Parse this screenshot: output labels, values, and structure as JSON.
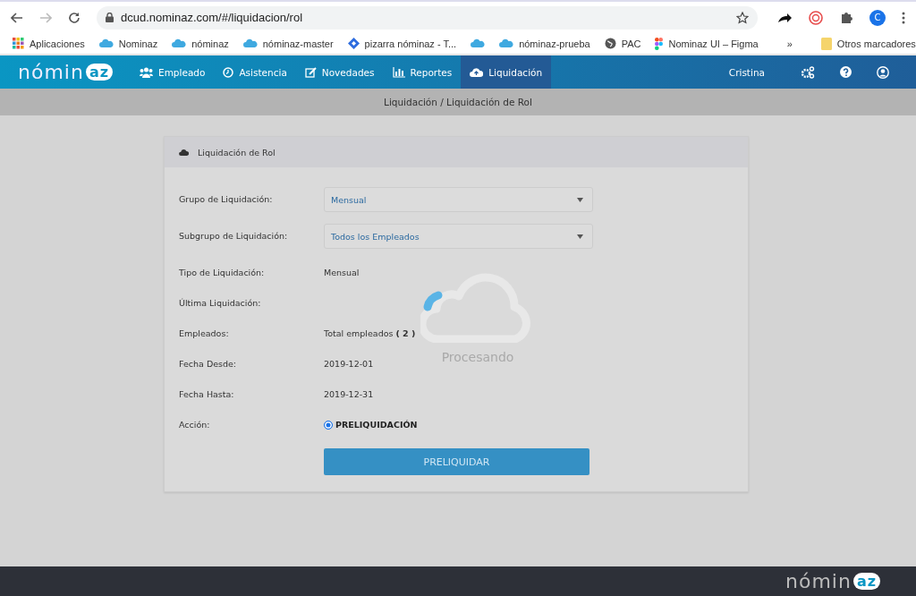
{
  "browser": {
    "url": "dcud.nominaz.com/#/liquidacion/rol",
    "profile_initial": "C",
    "bookmarks": [
      {
        "label": "Aplicaciones",
        "kind": "apps"
      },
      {
        "label": "Nominaz",
        "kind": "cloud"
      },
      {
        "label": "nóminaz",
        "kind": "cloud"
      },
      {
        "label": "nóminaz-master",
        "kind": "cloud"
      },
      {
        "label": "pizarra nóminaz - T...",
        "kind": "diamond"
      },
      {
        "kind": "cloud"
      },
      {
        "label": "nóminaz-prueba",
        "kind": "cloud"
      },
      {
        "label": "PAC",
        "kind": "globe"
      },
      {
        "label": "Nominaz UI – Figma",
        "kind": "figma"
      }
    ],
    "overflow": "»",
    "other_bookmarks": "Otros marcadores"
  },
  "logo": {
    "main": "nómin",
    "accent": "az"
  },
  "nav": [
    {
      "label": "Empleado",
      "selected": false
    },
    {
      "label": "Asistencia",
      "selected": false
    },
    {
      "label": "Novedades",
      "selected": false
    },
    {
      "label": "Reportes",
      "selected": false
    },
    {
      "label": "Liquidación",
      "selected": true
    }
  ],
  "user": "Cristina",
  "breadcrumb": "Liquidación / Liquidación de Rol",
  "card": {
    "title": "Liquidación de Rol",
    "rows": [
      {
        "label": "Grupo de Liquidación:",
        "kind": "select",
        "value": "Mensual"
      },
      {
        "label": "Subgrupo de Liquidación:",
        "kind": "select",
        "value": "Todos los Empleados"
      },
      {
        "label": "Tipo de Liquidación:",
        "kind": "text",
        "value": "Mensual"
      },
      {
        "label": "Última Liquidación:",
        "kind": "text"
      },
      {
        "label": "Empleados:",
        "kind": "text",
        "value": "Total empleados **( 2 )**"
      },
      {
        "label": "Fecha Desde:",
        "kind": "text",
        "value": "2019-12-01"
      },
      {
        "label": "Fecha Hasta:",
        "kind": "text",
        "value": "2019-12-31"
      },
      {
        "label": "Acción:",
        "kind": "radio",
        "value": "PRELIQUIDACIÓN",
        "selected": true
      }
    ],
    "button": "PRELIQUIDAR"
  },
  "overlay": {
    "message": "Procesando"
  },
  "footer_logo": {
    "main": "nómin",
    "accent": "az"
  }
}
